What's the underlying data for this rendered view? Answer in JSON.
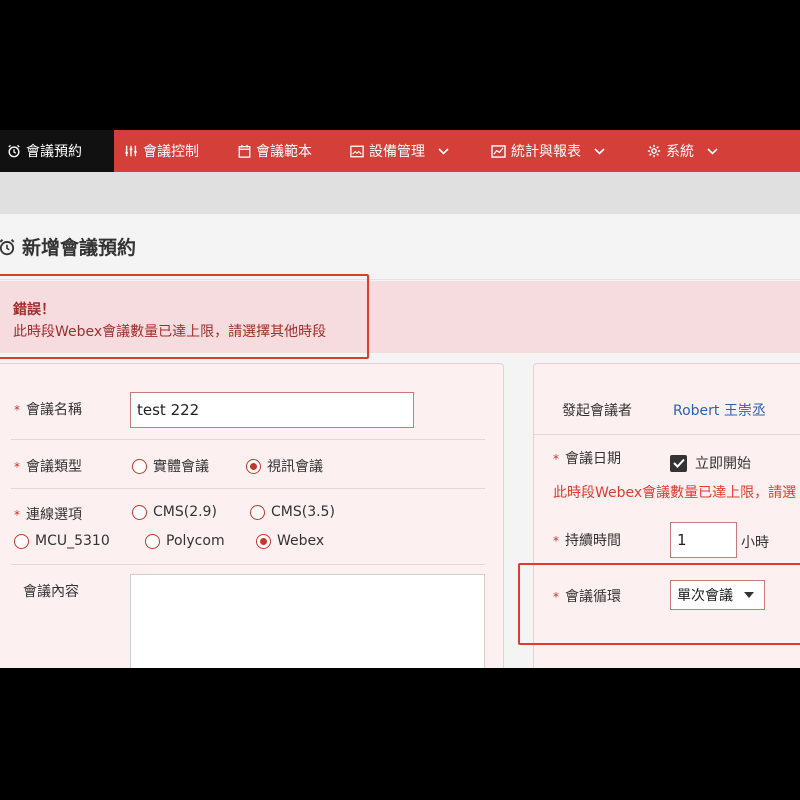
{
  "nav": {
    "brand": "會議預約",
    "items": [
      {
        "label": "會議控制",
        "has_dropdown": false
      },
      {
        "label": "會議範本",
        "has_dropdown": false
      },
      {
        "label": "設備管理",
        "has_dropdown": true
      },
      {
        "label": "統計與報表",
        "has_dropdown": true
      },
      {
        "label": "系統",
        "has_dropdown": true
      }
    ]
  },
  "page": {
    "title": "新增會議預約"
  },
  "alert": {
    "title": "錯誤！",
    "message": "此時段Webex會議數量已達上限，請選擇其他時段"
  },
  "form_left": {
    "name_label": "會議名稱",
    "name_value": "test 222",
    "type_label": "會議類型",
    "type_options": [
      {
        "label": "實體會議",
        "selected": false
      },
      {
        "label": "視訊會議",
        "selected": true
      }
    ],
    "connection_label": "連線選項",
    "connection_options": [
      {
        "label": "CMS(2.9)",
        "selected": false
      },
      {
        "label": "CMS(3.5)",
        "selected": false
      },
      {
        "label": "MCU_5310",
        "selected": false
      },
      {
        "label": "Polycom",
        "selected": false
      },
      {
        "label": "Webex",
        "selected": true
      }
    ],
    "content_label": "會議內容"
  },
  "form_right": {
    "initiator_label": "發起會議者",
    "initiator_value": "Robert 王崇丞",
    "date_label": "會議日期",
    "start_now_label": "立即開始",
    "start_now_checked": true,
    "date_error": "此時段Webex會議數量已達上限，請選",
    "duration_label": "持續時間",
    "duration_value": "1",
    "duration_unit": "小時",
    "recurrence_label": "會議循環",
    "recurrence_value": "單次會議"
  },
  "colors": {
    "nav_bg": "#d43f3a",
    "brand_bg": "#111111",
    "alert_bg": "#f7dcdf",
    "error_text": "#e03c2e",
    "link": "#2b5fb4"
  }
}
